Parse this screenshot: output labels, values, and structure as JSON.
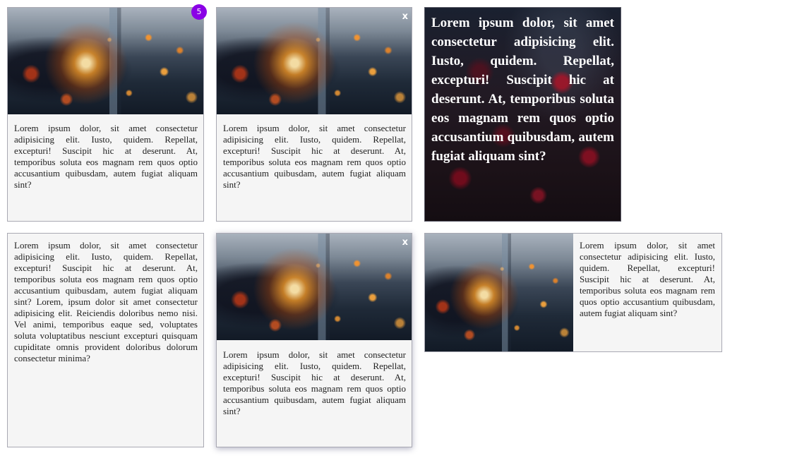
{
  "cards": [
    {
      "badge": "5",
      "text": "Lorem ipsum dolor, sit amet consectetur adipisicing elit. Iusto, quidem. Repellat, excepturi! Suscipit hic at deserunt. At, temporibus soluta eos magnam rem quos optio accusantium quibusdam, autem fugiat aliquam sint?"
    },
    {
      "close_label": "x",
      "text": "Lorem ipsum dolor, sit amet consectetur adipisicing elit. Iusto, quidem. Repellat, excepturi! Suscipit hic at deserunt. At, temporibus soluta eos magnam rem quos optio accusantium quibusdam, autem fugiat aliquam sint?"
    },
    {
      "text": "Lorem ipsum dolor, sit amet consectetur adipisicing elit. Iusto, quidem. Repellat, excepturi! Suscipit hic at deserunt. At, temporibus soluta eos magnam rem quos optio accusantium quibusdam, autem fugiat aliquam sint?"
    },
    {
      "text": "Lorem ipsum dolor, sit amet consectetur adipisicing elit. Iusto, quidem. Repellat, excepturi! Suscipit hic at deserunt. At, temporibus soluta eos magnam rem quos optio accusantium quibusdam, autem fugiat aliquam sint? Lorem, ipsum dolor sit amet consectetur adipisicing elit. Reiciendis doloribus nemo nisi. Vel animi, temporibus eaque sed, voluptates soluta voluptatibus nesciunt excepturi quisquam cupiditate omnis provident doloribus dolorum consectetur minima?"
    },
    {
      "close_label": "x",
      "text": "Lorem ipsum dolor, sit amet consectetur adipisicing elit. Iusto, quidem. Repellat, excepturi! Suscipit hic at deserunt. At, temporibus soluta eos magnam rem quos optio accusantium quibusdam, autem fugiat aliquam sint?"
    },
    {
      "text": "Lorem ipsum dolor, sit amet consectetur adipisicing elit. Iusto, quidem. Repellat, excepturi! Suscipit hic at deserunt. At, temporibus soluta eos magnam rem quos optio accusantium quibusdam, autem fugiat aliquam sint?"
    }
  ],
  "colors": {
    "card_background": "#f5f5f5",
    "card_border": "#a9a9b3",
    "badge": "#8a00e6"
  },
  "icons": {
    "badge": "notification-badge",
    "close": "close-icon",
    "photo": "grinder-sparks-image",
    "overlay_photo": "red-bokeh-image"
  }
}
